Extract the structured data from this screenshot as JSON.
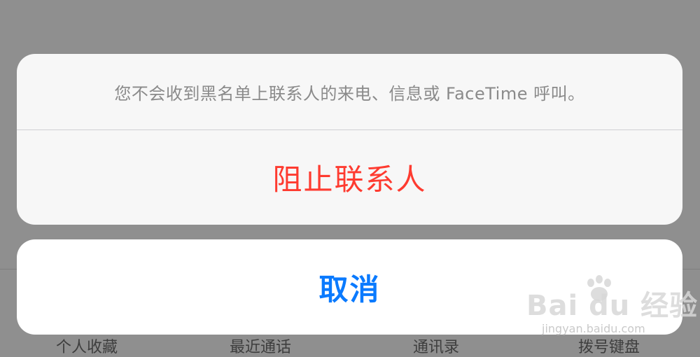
{
  "background_app": {
    "tabs": [
      {
        "label": "个人收藏"
      },
      {
        "label": "最近通话"
      },
      {
        "label": "通讯录"
      },
      {
        "label": "拨号键盘"
      }
    ]
  },
  "action_sheet": {
    "message": "您不会收到黑名单上联系人的来电、信息或 FaceTime 呼叫。",
    "destructive_action_label": "阻止联系人",
    "cancel_label": "取消"
  },
  "watermark": {
    "main_text": "Bai du 经验",
    "sub_text": "jingyan.baidu.com"
  },
  "colors": {
    "destructive": "#fe3b30",
    "accent": "#0a7afe",
    "overlay": "#8f8f8f"
  }
}
